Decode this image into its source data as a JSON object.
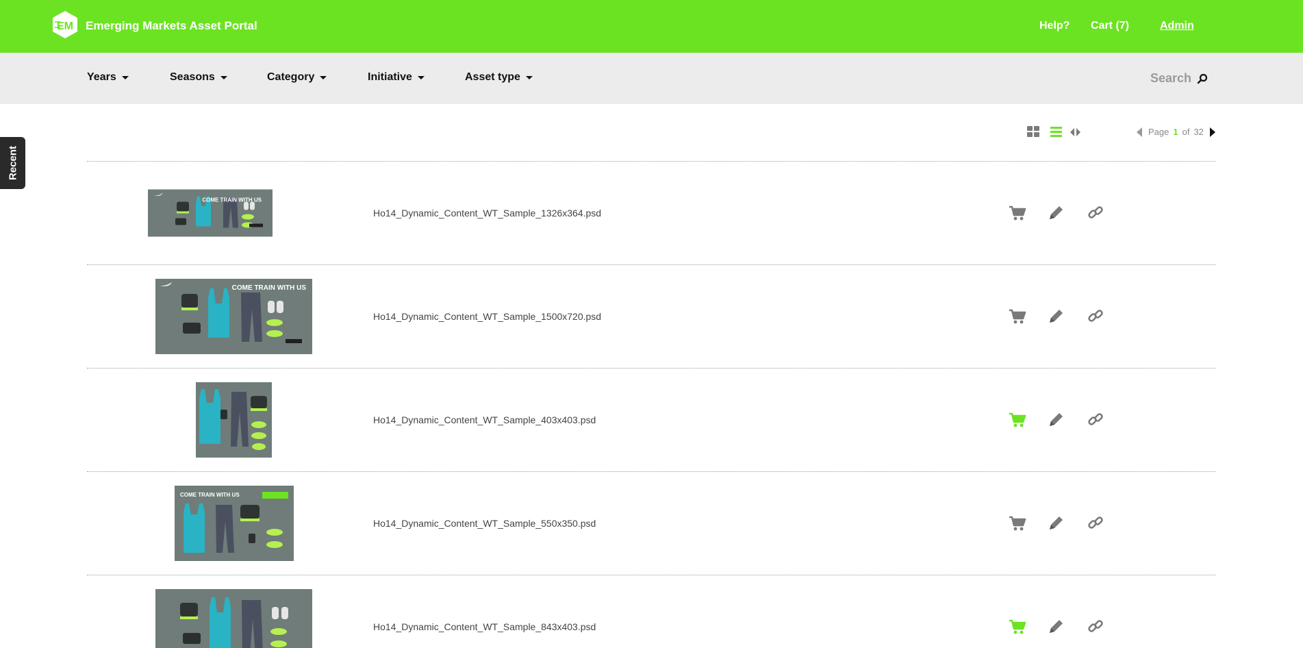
{
  "header": {
    "brand": "Emerging Markets Asset Portal",
    "logo_text": "EM",
    "links": {
      "help": "Help?",
      "cart": "Cart (7)",
      "admin": "Admin"
    }
  },
  "filters": [
    {
      "label": "Years"
    },
    {
      "label": "Seasons"
    },
    {
      "label": "Category"
    },
    {
      "label": "Initiative"
    },
    {
      "label": "Asset type"
    }
  ],
  "search": {
    "placeholder": "Search"
  },
  "recent_tab": "Recent",
  "pager": {
    "page_word": "Page",
    "current": "1",
    "of_word": "of",
    "total": "32"
  },
  "colors": {
    "accent": "#6ce322",
    "icon_gray": "#7a7a7a",
    "filter_bg": "#ececec"
  },
  "assets": [
    {
      "name": "Ho14_Dynamic_Content_WT_Sample_1326x364.psd",
      "thumb_text": "COME TRAIN WITH US",
      "in_cart": false
    },
    {
      "name": "Ho14_Dynamic_Content_WT_Sample_1500x720.psd",
      "thumb_text": "COME TRAIN WITH US",
      "in_cart": false
    },
    {
      "name": "Ho14_Dynamic_Content_WT_Sample_403x403.psd",
      "thumb_text": "",
      "in_cart": true
    },
    {
      "name": "Ho14_Dynamic_Content_WT_Sample_550x350.psd",
      "thumb_text": "COME TRAIN WITH US",
      "in_cart": false
    },
    {
      "name": "Ho14_Dynamic_Content_WT_Sample_843x403.psd",
      "thumb_text": "",
      "in_cart": true
    }
  ]
}
